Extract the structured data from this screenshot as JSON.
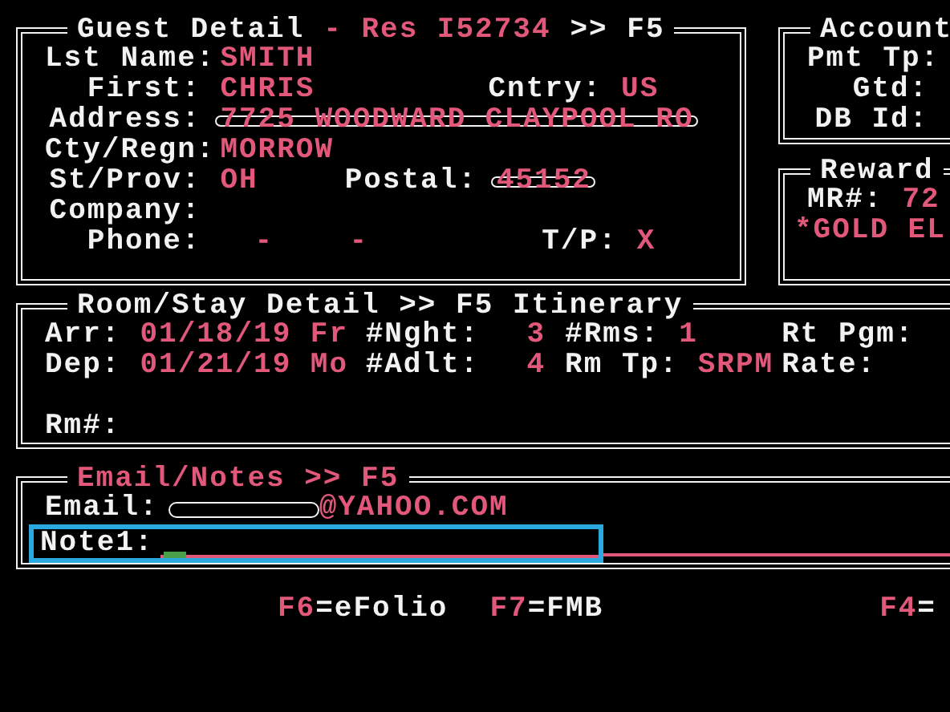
{
  "guest_detail": {
    "title": [
      {
        "text": "Guest Detail",
        "kind": "label"
      },
      {
        "text": "- Res I52734",
        "kind": "value"
      },
      {
        "text": ">> F5",
        "kind": "label"
      }
    ],
    "rows": [
      {
        "label": "Lst Name:",
        "value": "SMITH"
      },
      {
        "label": "First:",
        "value": "CHRIS",
        "extra": {
          "label": "Cntry:",
          "value": "US"
        }
      },
      {
        "label": "Address:",
        "value": "7725 WOODWARD CLAYPOOL RO",
        "struck": true
      },
      {
        "label": "Cty/Regn:",
        "value": "MORROW"
      },
      {
        "label": "St/Prov:",
        "value": "OH",
        "extra": {
          "label": "Postal:",
          "value": "45152",
          "struck": true
        }
      },
      {
        "label": "Company:"
      },
      {
        "label": "Phone:",
        "value": "-    -",
        "extra": {
          "label": "T/P:",
          "value": "X"
        }
      }
    ]
  },
  "account": {
    "title": "Account",
    "rows": [
      {
        "label": "Pmt Tp:"
      },
      {
        "label": "Gtd:"
      },
      {
        "label": "DB Id:"
      }
    ]
  },
  "rewards": {
    "title": "Reward",
    "rows": [
      {
        "label": "MR#:",
        "value": "72"
      },
      {
        "value": "*GOLD EL"
      }
    ]
  },
  "room_stay": {
    "title": "Room/Stay Detail >> F5 Itinerary",
    "rows": [
      [
        {
          "label": "Arr:",
          "value": "01/18/19 Fr"
        },
        {
          "label": "#Nght:",
          "value": "3"
        },
        {
          "label": "#Rms:",
          "value": "1"
        },
        {
          "label": "Rt Pgm:"
        }
      ],
      [
        {
          "label": "Dep:",
          "value": "01/21/19 Mo"
        },
        {
          "label": "#Adlt:",
          "value": "4"
        },
        {
          "label": "Rm Tp:",
          "value": "SRPM"
        },
        {
          "label": "Rate:"
        }
      ]
    ],
    "room_label": "Rm#:"
  },
  "email_notes": {
    "title": "Email/Notes >> F5",
    "email_label": "Email:",
    "email_redacted": true,
    "email_value": "@YAHOO.COM",
    "note_label": "Note1:",
    "note_focused": true
  },
  "function_keys": [
    {
      "key": "F6",
      "text": "=eFolio"
    },
    {
      "key": "F7",
      "text": "=FMB"
    },
    {
      "key": "F4",
      "text": "="
    }
  ]
}
